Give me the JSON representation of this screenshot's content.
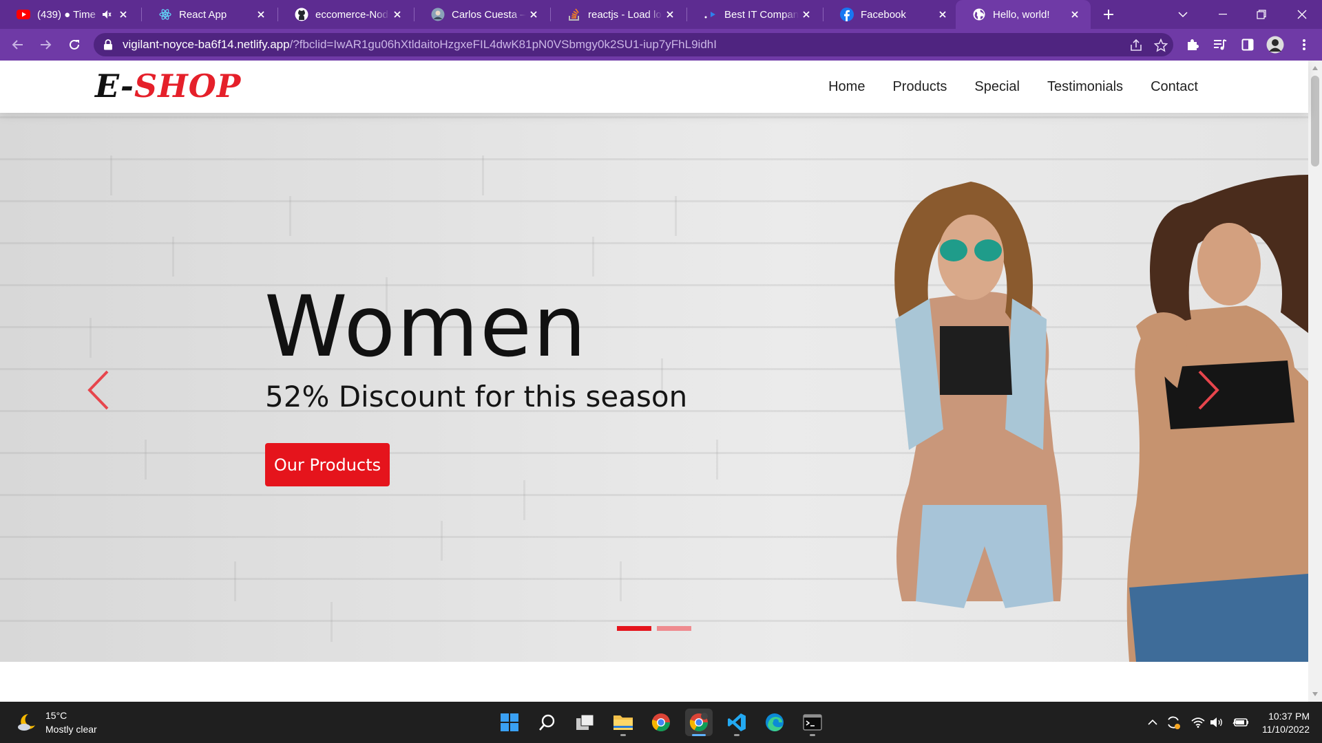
{
  "browser": {
    "tabs": [
      {
        "title": "(439) ● Time",
        "icon": "youtube-icon",
        "active": false
      },
      {
        "title": "React App",
        "icon": "react-icon",
        "active": false
      },
      {
        "title": "eccomerce-Node",
        "icon": "github-icon",
        "active": false
      },
      {
        "title": "Carlos Cuesta – A",
        "icon": "avatar-icon",
        "active": false
      },
      {
        "title": "reactjs - Load loc",
        "icon": "stackoverflow-icon",
        "active": false
      },
      {
        "title": "Best IT Company",
        "icon": "arrow-favicon-icon",
        "active": false
      },
      {
        "title": "Facebook",
        "icon": "facebook-icon",
        "active": false
      },
      {
        "title": "Hello, world!",
        "icon": "globe-icon",
        "active": true
      }
    ],
    "url_host": "vigilant-noyce-ba6f14.netlify.app",
    "url_rest": "/?fbclid=IwAR1gu06hXtldaitoHzgxeFIL4dwK81pN0VSbmgy0k2SU1-iup7yFhL9idhI",
    "colors": {
      "tabstrip": "#5d2c91",
      "toolbar": "#6f3aa6"
    }
  },
  "site": {
    "logo_part1": "E-",
    "logo_part2": "SHOP",
    "nav": [
      "Home",
      "Products",
      "Special",
      "Testimonials",
      "Contact"
    ],
    "hero": {
      "title": "Women",
      "subtitle": "52% Discount for this season",
      "button": "Our Products",
      "slide_count": 2,
      "active_slide": 1
    },
    "colors": {
      "accent": "#e5141c",
      "indicator_inactive": "#ef8b8f"
    }
  },
  "taskbar": {
    "weather_temp": "15°C",
    "weather_desc": "Mostly clear",
    "time": "10:37 PM",
    "date": "11/10/2022",
    "apps": [
      "start-icon",
      "search-icon",
      "task-view-icon",
      "file-explorer-icon",
      "chrome-icon",
      "chrome-active-icon",
      "vscode-icon",
      "edge-icon",
      "terminal-icon"
    ]
  }
}
